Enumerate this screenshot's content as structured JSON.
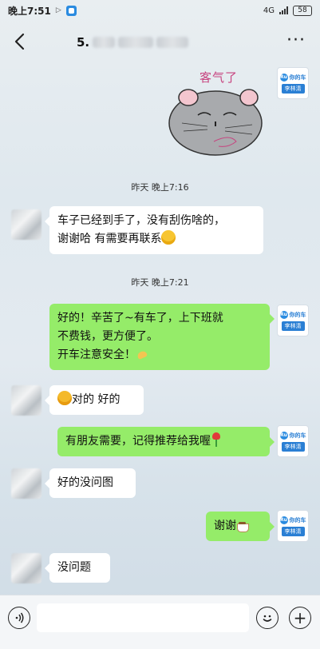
{
  "status_bar": {
    "time": "晚上7:51",
    "network": "4G",
    "battery": "58"
  },
  "nav": {
    "title_visible": "5."
  },
  "sticker": {
    "text": "客气了"
  },
  "brand_avatar": {
    "logo_text": "你的车",
    "name": "李林清"
  },
  "timestamps": [
    "昨天 晚上7:16",
    "昨天 晚上7:21"
  ],
  "messages": [
    {
      "side": "in",
      "text": "车子已经到手了，没有刮伤啥的，",
      "text2": "谢谢哈 有需要再联系"
    },
    {
      "side": "out",
      "line1": "好的！辛苦了~有车了，上下班就",
      "line2": "不费钱，更方便了。",
      "line3": "开车注意安全！"
    },
    {
      "side": "in",
      "text": "对的 好的"
    },
    {
      "side": "out",
      "text": "有朋友需要，记得推荐给我喔"
    },
    {
      "side": "in",
      "text": "好的没问图"
    },
    {
      "side": "out",
      "text": "谢谢"
    },
    {
      "side": "in",
      "text": "没问题"
    }
  ]
}
